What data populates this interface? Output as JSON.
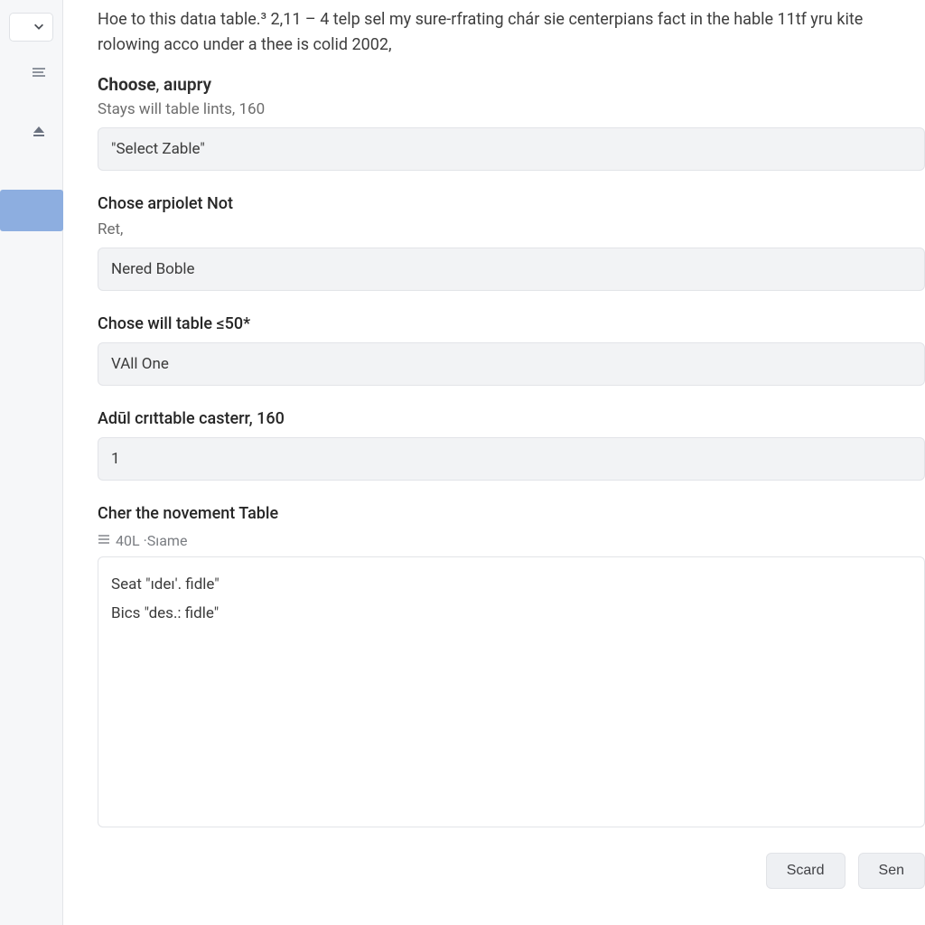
{
  "intro": "Hoe to this datıa table.³ 2,11 – 4 telp sel my sure-rfrating chár sie centerpians fact in the hable 11tf yru kite rolowing acco under a thee is colid 2002,",
  "sections": {
    "choose": {
      "heading_bold": "Choose",
      "heading_rest": "aıupry",
      "hint": "Stays will table lints, 160",
      "value": "\"Select Zable\""
    },
    "arpiolet": {
      "label": "Chose arpiolet Not",
      "hint": "Ret,",
      "value": "Nered Boble"
    },
    "willtable": {
      "label": "Chose will table ≤50*",
      "value": "VAll One"
    },
    "crittable": {
      "label": "Adūl crıttable casterr, 160",
      "value": "1"
    },
    "novement": {
      "label": "Cher the novement Table",
      "meta": "40L ·Sıame",
      "text": "Seat \"ıdeı'. fidle\"\nBics \"des.: fidle\""
    }
  },
  "footer": {
    "scard": "Scard",
    "send": "Sen"
  }
}
